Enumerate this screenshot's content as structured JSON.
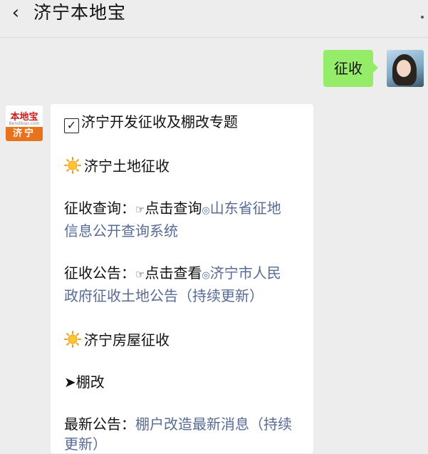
{
  "header": {
    "back_icon": "chevron-left-icon",
    "title": "济宁本地宝",
    "more_icon": "more-dots-icon"
  },
  "outgoing": {
    "text": "征收",
    "bubble_color": "#95ec69"
  },
  "bot": {
    "avatar_logo": "本地宝",
    "avatar_domain": "Bendibao.com",
    "avatar_city": "济宁",
    "accent_color": "#e8731d"
  },
  "incoming": {
    "heading": "济宁开发征收及棚改专题",
    "section1_title": "济宁土地征收",
    "query_label": "征收查询：",
    "query_action": "点击查询",
    "query_link_1": "山东省征地",
    "query_link_2": "信息公开查询系统",
    "notice_label": "征收公告：",
    "notice_action": "点击查看",
    "notice_link_1": "济宁市人民",
    "notice_link_2": "政府征收土地公告（持续更新）",
    "section2_title": "济宁房屋征收",
    "sub_title": "棚改",
    "latest_label": "最新公告：",
    "latest_link_1": "棚户改造最新消息（持续",
    "latest_link_2": "更新）",
    "link_color": "#576b95"
  }
}
